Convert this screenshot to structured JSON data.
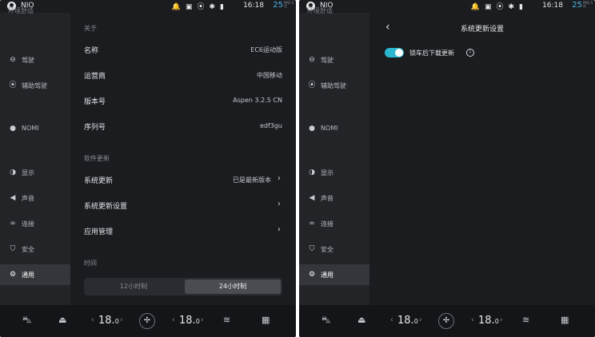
{
  "status": {
    "brand": "NIO",
    "icons": [
      "bell-icon",
      "camera-icon",
      "signal-wave-icon",
      "bluetooth-icon",
      "cellular-icon"
    ],
    "time": "16:18",
    "temperature": "25",
    "temp_unit": "PM2.5 优"
  },
  "sidebar": {
    "cut_item": "环境舒适",
    "items": [
      {
        "label": "驾驶",
        "icon": "steering-icon"
      },
      {
        "label": "辅助驾驶",
        "icon": "assist-icon"
      },
      {
        "label": "NOMI",
        "icon": "nomi-icon"
      },
      {
        "label": "显示",
        "icon": "display-icon"
      },
      {
        "label": "声音",
        "icon": "sound-icon"
      },
      {
        "label": "连接",
        "icon": "link-icon"
      },
      {
        "label": "安全",
        "icon": "shield-icon"
      },
      {
        "label": "通用",
        "icon": "gear-icon"
      }
    ],
    "active_label": "通用"
  },
  "about": {
    "header": "关于",
    "rows": [
      {
        "key": "名称",
        "value": "EC6运动版"
      },
      {
        "key": "运营商",
        "value": "中国移动"
      },
      {
        "key": "版本号",
        "value": "Aspen 3.2.5 CN"
      },
      {
        "key": "序列号",
        "value": "edf3gu"
      }
    ]
  },
  "software": {
    "header": "软件更新",
    "rows": [
      {
        "key": "系统更新",
        "value": "已是最新版本"
      },
      {
        "key": "系统更新设置",
        "value": ""
      },
      {
        "key": "应用管理",
        "value": ""
      }
    ]
  },
  "time": {
    "header": "时间",
    "options": [
      "12小时制",
      "24小时制"
    ],
    "selected": "24小时制"
  },
  "update_settings": {
    "title": "系统更新设置",
    "toggle_label": "锁车后下载更新",
    "toggle_on": true
  },
  "climate": {
    "left_temp_int": "18.",
    "left_temp_dec": "0",
    "right_temp_int": "18.",
    "right_temp_dec": "0",
    "icons": [
      "car-seat-icon",
      "car-airflow-icon",
      "fan-icon",
      "front-defrost-icon",
      "rear-defrost-icon"
    ]
  }
}
